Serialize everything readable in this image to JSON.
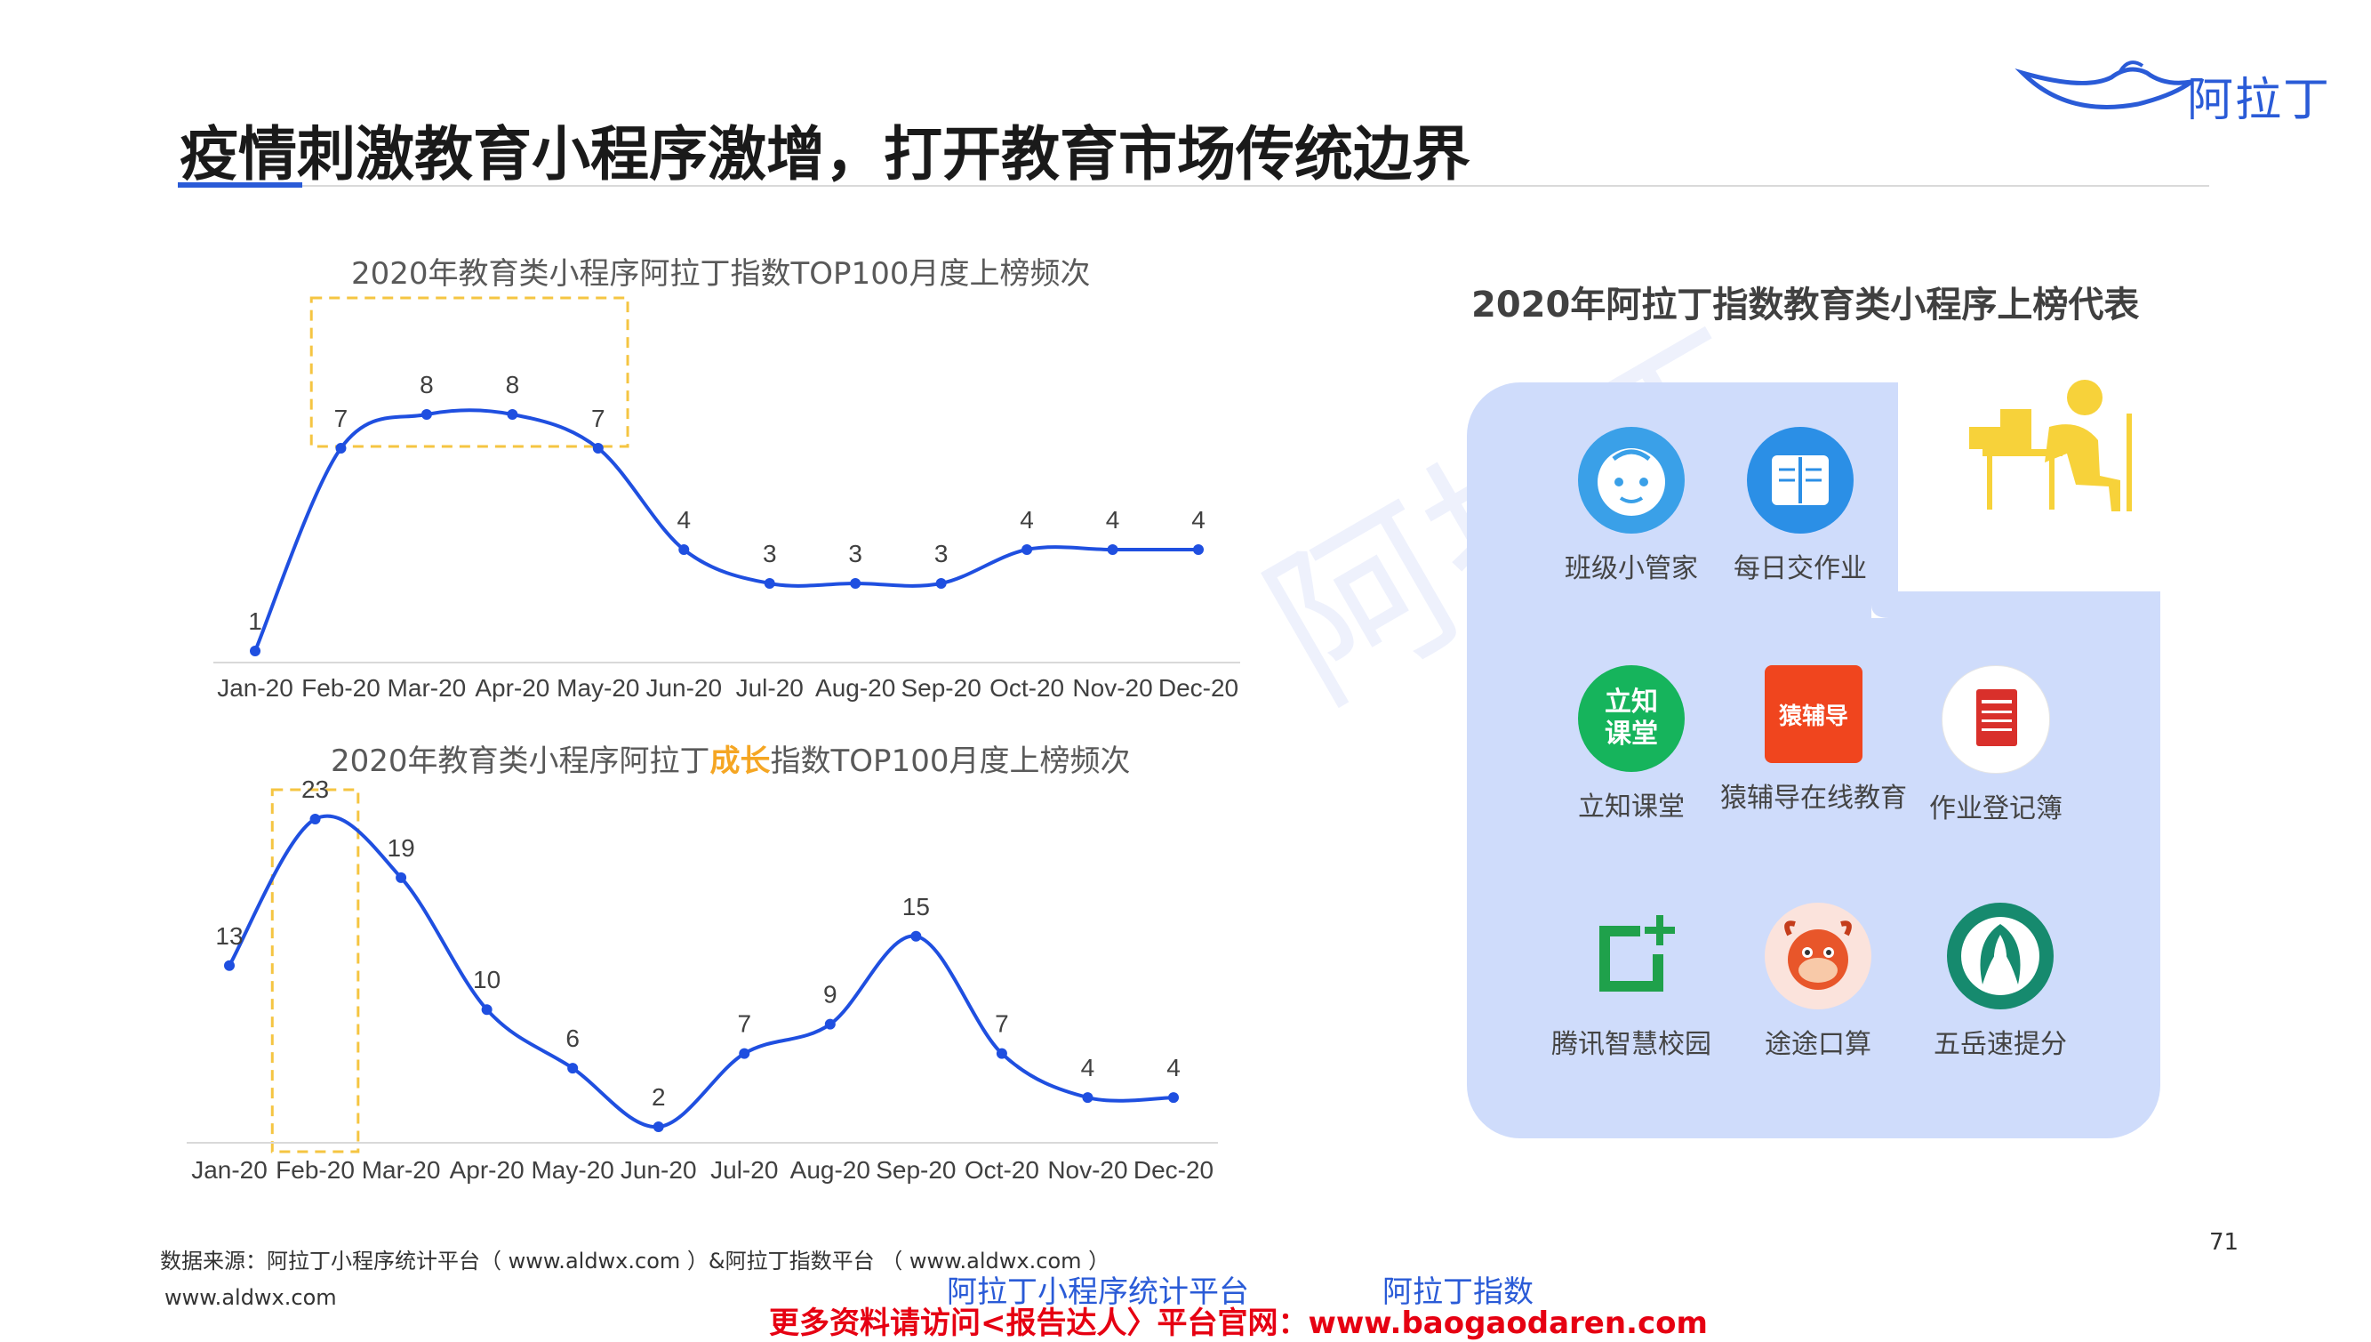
{
  "header": {
    "title": "疫情刺激教育小程序激增，打开教育市场传统边界",
    "logo_text": "阿拉丁"
  },
  "colors": {
    "line": "#1f4fe0",
    "highlight_box": "#f5c542",
    "accent": "#2a5bd7",
    "panel": "#cfdcfb",
    "promo": "#e60012"
  },
  "watermark": "阿拉丁",
  "chart_data": [
    {
      "type": "line",
      "title": "2020年教育类小程序阿拉丁指数TOP100月度上榜频次",
      "categories": [
        "Jan-20",
        "Feb-20",
        "Mar-20",
        "Apr-20",
        "May-20",
        "Jun-20",
        "Jul-20",
        "Aug-20",
        "Sep-20",
        "Oct-20",
        "Nov-20",
        "Dec-20"
      ],
      "values": [
        1,
        7,
        8,
        8,
        7,
        4,
        3,
        3,
        3,
        4,
        4,
        4
      ],
      "ylim": [
        0,
        10
      ],
      "highlight_range": [
        "Feb-20",
        "May-20"
      ],
      "data_labels": true,
      "grid": false
    },
    {
      "type": "line",
      "title": {
        "before": "2020年教育类小程序阿拉丁",
        "highlight": "成长",
        "after": "指数TOP100月度上榜频次"
      },
      "categories": [
        "Jan-20",
        "Feb-20",
        "Mar-20",
        "Apr-20",
        "May-20",
        "Jun-20",
        "Jul-20",
        "Aug-20",
        "Sep-20",
        "Oct-20",
        "Nov-20",
        "Dec-20"
      ],
      "values": [
        13,
        23,
        19,
        10,
        6,
        2,
        7,
        9,
        15,
        7,
        4,
        4
      ],
      "ylim": [
        0,
        25
      ],
      "highlight_range": [
        "Feb-20",
        "Feb-20"
      ],
      "data_labels": true,
      "grid": false
    }
  ],
  "right_panel": {
    "title": "2020年阿拉丁指数教育类小程序上榜代表",
    "apps": [
      {
        "name": "班级小管家",
        "icon": "baby-face-icon",
        "color": "#3aa0e8"
      },
      {
        "name": "每日交作业",
        "icon": "notebook-icon",
        "color": "#2b8fe6"
      },
      {
        "name": "立知课堂",
        "icon": "lizhi-logo-icon",
        "color": "#16b45c",
        "logo_text": "立知课堂"
      },
      {
        "name": "猿辅导在线教育",
        "icon": "yuanfudao-logo-icon",
        "color": "#f0451e",
        "logo_text": "猿辅导"
      },
      {
        "name": "作业登记簿",
        "icon": "homework-book-icon",
        "color": "#d9302b"
      },
      {
        "name": "腾讯智慧校园",
        "icon": "tencent-campus-icon",
        "color": "#1fa14b"
      },
      {
        "name": "途途口算",
        "icon": "cartoon-ox-icon",
        "color": "#e8562a"
      },
      {
        "name": "五岳速提分",
        "icon": "wuyue-logo-icon",
        "color": "#168a6e"
      }
    ]
  },
  "footer": {
    "source": "数据来源：阿拉丁小程序统计平台（ www.aldwx.com ）&阿拉丁指数平台 （ www.aldwx.com ）",
    "url": "www.aldwx.com",
    "page_number": "71",
    "brand1": "阿拉丁小程序统计平台",
    "brand2": "阿拉丁指数",
    "promo": "更多资料请访问<报告达人〉平台官网：www.baogaodaren.com"
  }
}
